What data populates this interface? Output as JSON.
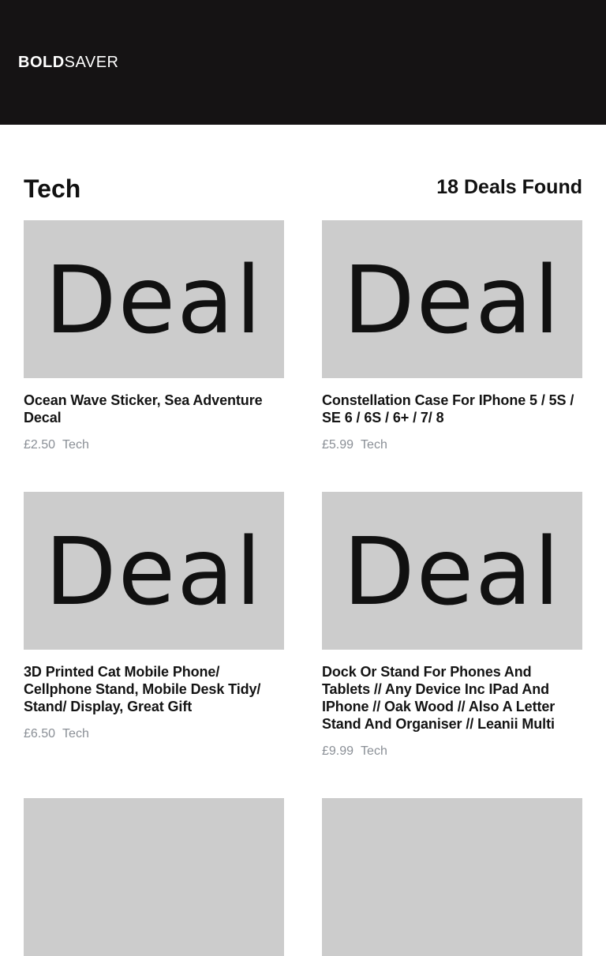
{
  "header": {
    "logo_bold": "BOLD",
    "logo_light": "SAVER",
    "background": "#151314"
  },
  "page": {
    "title": "Tech",
    "deals_found": "18 Deals Found"
  },
  "deals": [
    {
      "image_text": "Deal",
      "title": "Ocean Wave Sticker, Sea Adventure Decal",
      "price": "£2.50",
      "category": "Tech"
    },
    {
      "image_text": "Deal",
      "title": "Constellation Case For IPhone 5 / 5S / SE 6 / 6S / 6+ / 7/ 8",
      "price": "£5.99",
      "category": "Tech"
    },
    {
      "image_text": "Deal",
      "title": "3D Printed Cat Mobile Phone/ Cellphone Stand, Mobile Desk Tidy/ Stand/ Display, Great Gift",
      "price": "£6.50",
      "category": "Tech"
    },
    {
      "image_text": "Deal",
      "title": "Dock Or Stand For Phones And Tablets // Any Device Inc IPad And IPhone // Oak Wood // Also A Letter Stand And Organiser // Leanii Multi",
      "price": "£9.99",
      "category": "Tech"
    }
  ],
  "colors": {
    "thumb_bg": "#cccccc",
    "meta_text": "#8a8f96"
  }
}
